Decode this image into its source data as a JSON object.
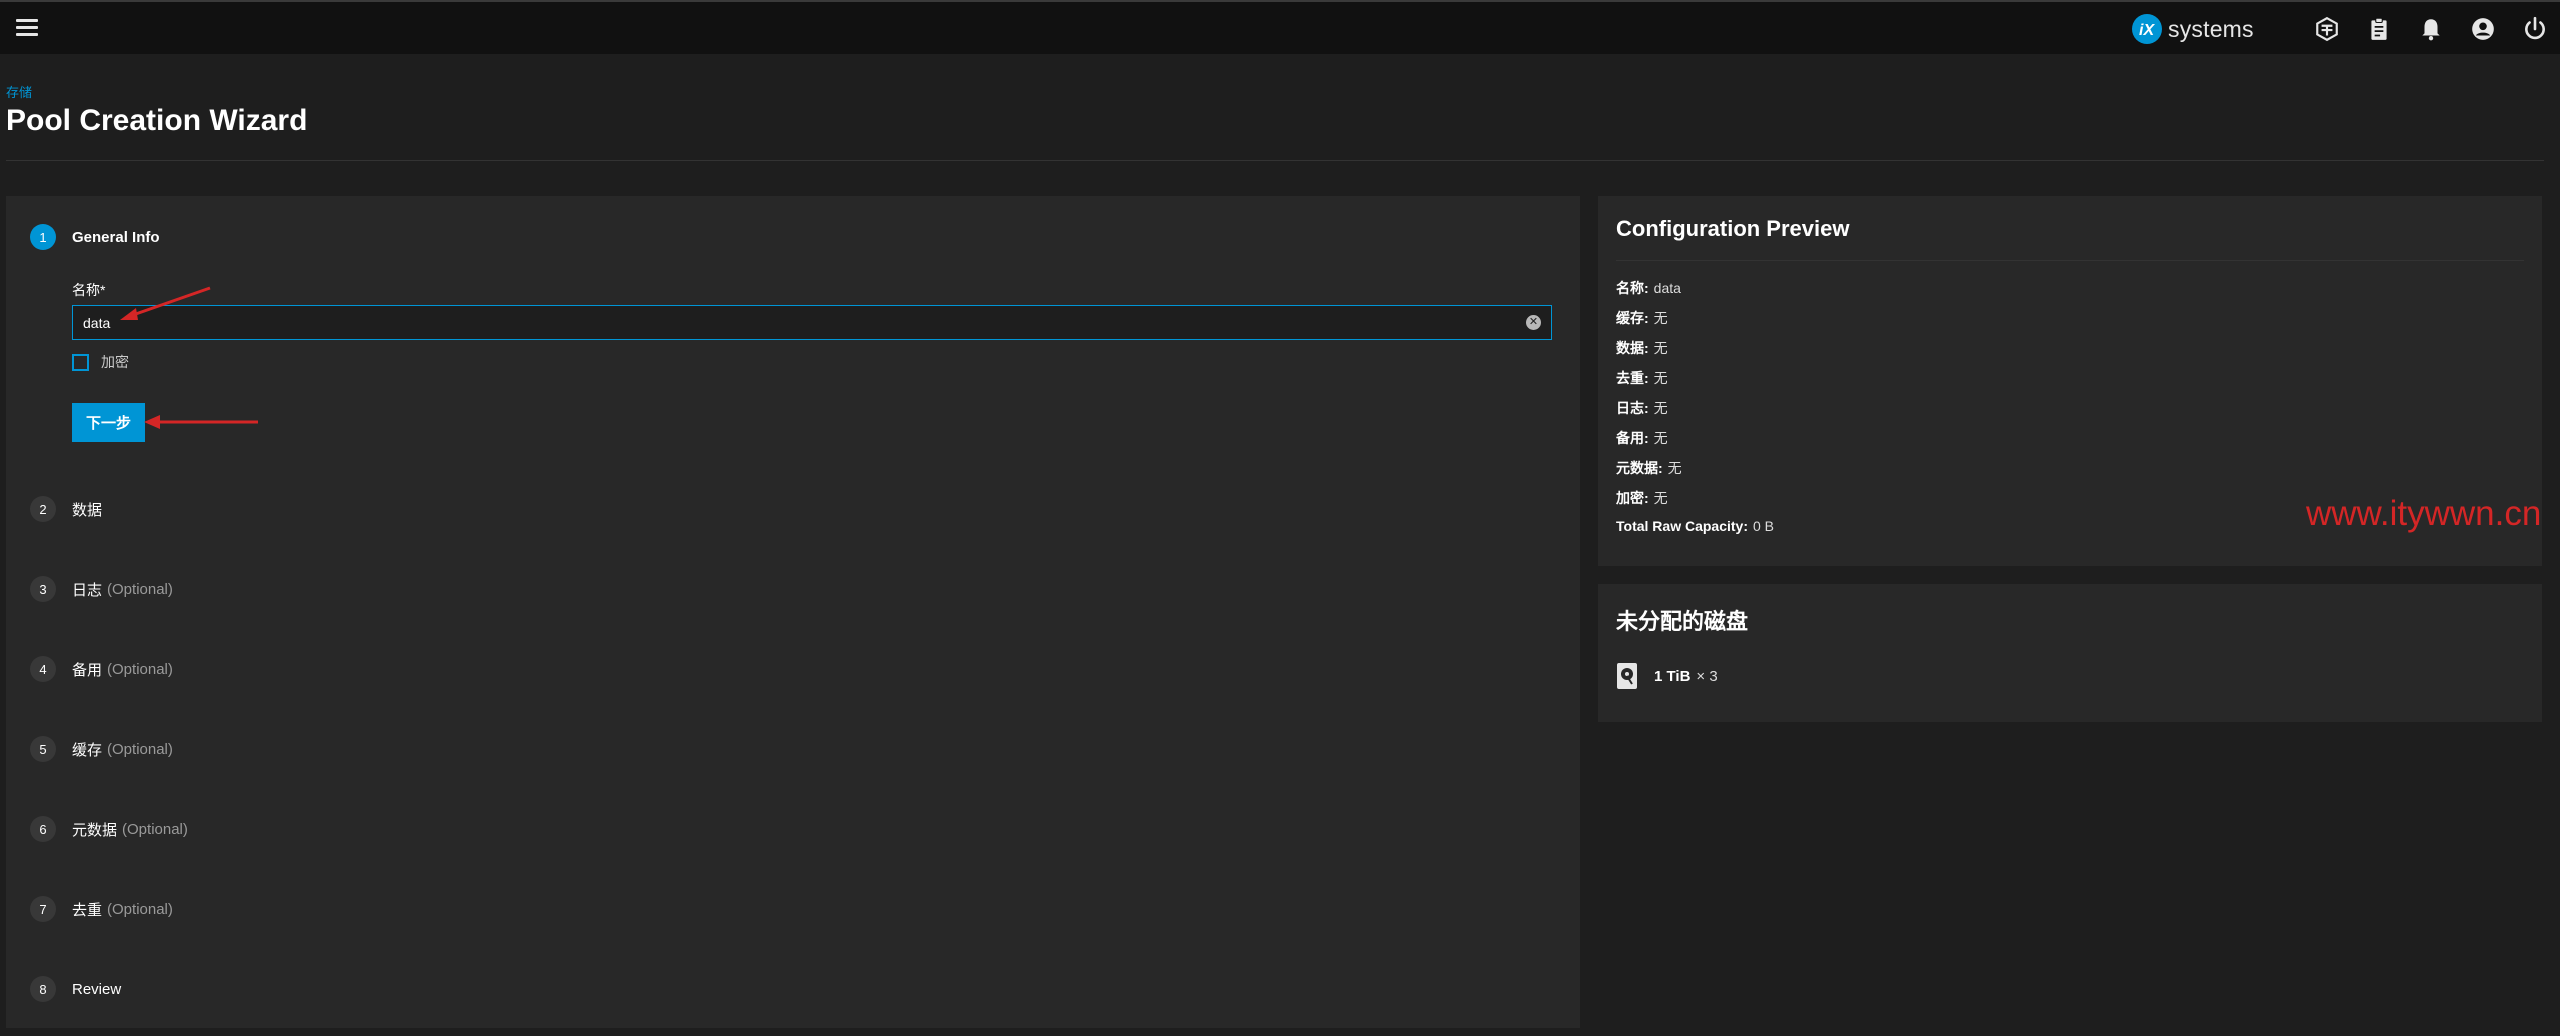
{
  "topbar": {
    "logo_text": "systems",
    "icons": [
      "menu-icon",
      "truecommand-icon",
      "clipboard-icon",
      "bell-icon",
      "account-icon",
      "power-icon"
    ]
  },
  "header": {
    "breadcrumb": "存储",
    "title": "Pool Creation Wizard"
  },
  "wizard": {
    "steps": [
      {
        "num": "1",
        "label": "General Info",
        "optional": ""
      },
      {
        "num": "2",
        "label": "数据",
        "optional": ""
      },
      {
        "num": "3",
        "label": "日志",
        "optional": "(Optional)"
      },
      {
        "num": "4",
        "label": "备用",
        "optional": "(Optional)"
      },
      {
        "num": "5",
        "label": "缓存",
        "optional": "(Optional)"
      },
      {
        "num": "6",
        "label": "元数据",
        "optional": "(Optional)"
      },
      {
        "num": "7",
        "label": "去重",
        "optional": "(Optional)"
      },
      {
        "num": "8",
        "label": "Review",
        "optional": ""
      }
    ],
    "name_label": "名称*",
    "name_value": "data",
    "encryption_label": "加密",
    "next_label": "下一步"
  },
  "preview": {
    "title": "Configuration Preview",
    "rows": [
      {
        "key": "名称:",
        "value": "data"
      },
      {
        "key": "缓存:",
        "value": "无"
      },
      {
        "key": "数据:",
        "value": "无"
      },
      {
        "key": "去重:",
        "value": "无"
      },
      {
        "key": "日志:",
        "value": "无"
      },
      {
        "key": "备用:",
        "value": "无"
      },
      {
        "key": "元数据:",
        "value": "无"
      },
      {
        "key": "加密:",
        "value": "无"
      },
      {
        "key": "Total Raw Capacity:",
        "value": "0 B"
      }
    ]
  },
  "disks": {
    "title": "未分配的磁盘",
    "size": "1 TiB",
    "count": "× 3"
  },
  "watermark": "www.itywwn.cn",
  "colors": {
    "accent": "#0095d5",
    "annotation": "#d42626",
    "background": "#1e1e1e",
    "panel": "#282828"
  }
}
